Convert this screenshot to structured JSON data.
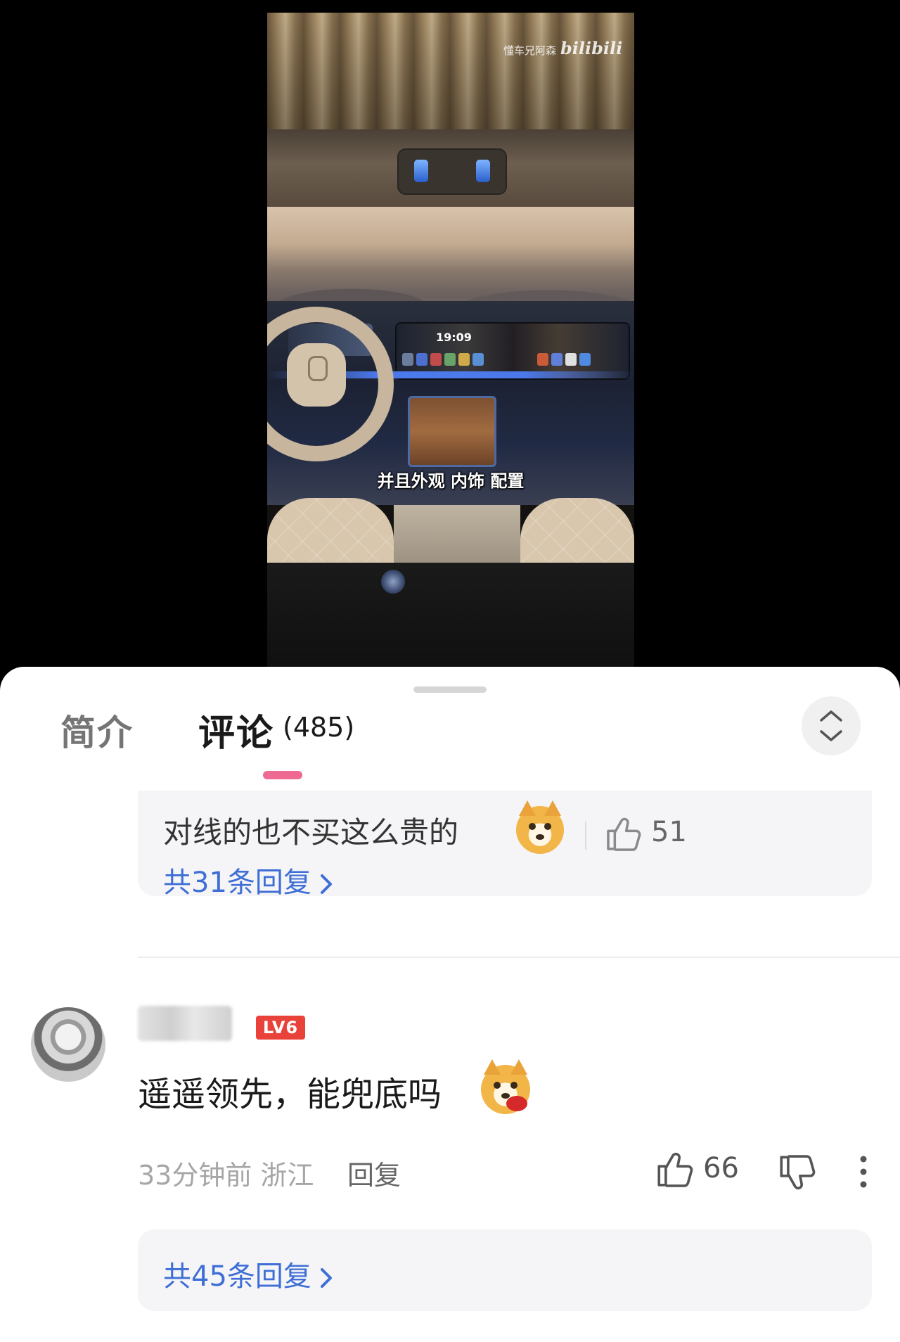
{
  "video": {
    "watermark_author": "懂车兄阿森",
    "watermark_brand": "bilibili",
    "subtitle": "并且外观 内饰 配置",
    "screen_time": "19:09"
  },
  "tabs": {
    "intro": "简介",
    "comments": "评论",
    "comments_count": "(485)"
  },
  "first_comment_tail": {
    "text": "对线的也不买这么贵的",
    "likes": "51",
    "replies_link": "共31条回复"
  },
  "comment": {
    "level": "LV6",
    "text": "遥遥领先，能兜底吗",
    "time_location": "33分钟前 浙江",
    "reply_label": "回复",
    "likes": "66",
    "replies_link": "共45条回复"
  },
  "colors": {
    "accent_pink": "#ee6a92",
    "link_blue": "#3f6fd6",
    "level_badge_red": "#e8423a"
  }
}
